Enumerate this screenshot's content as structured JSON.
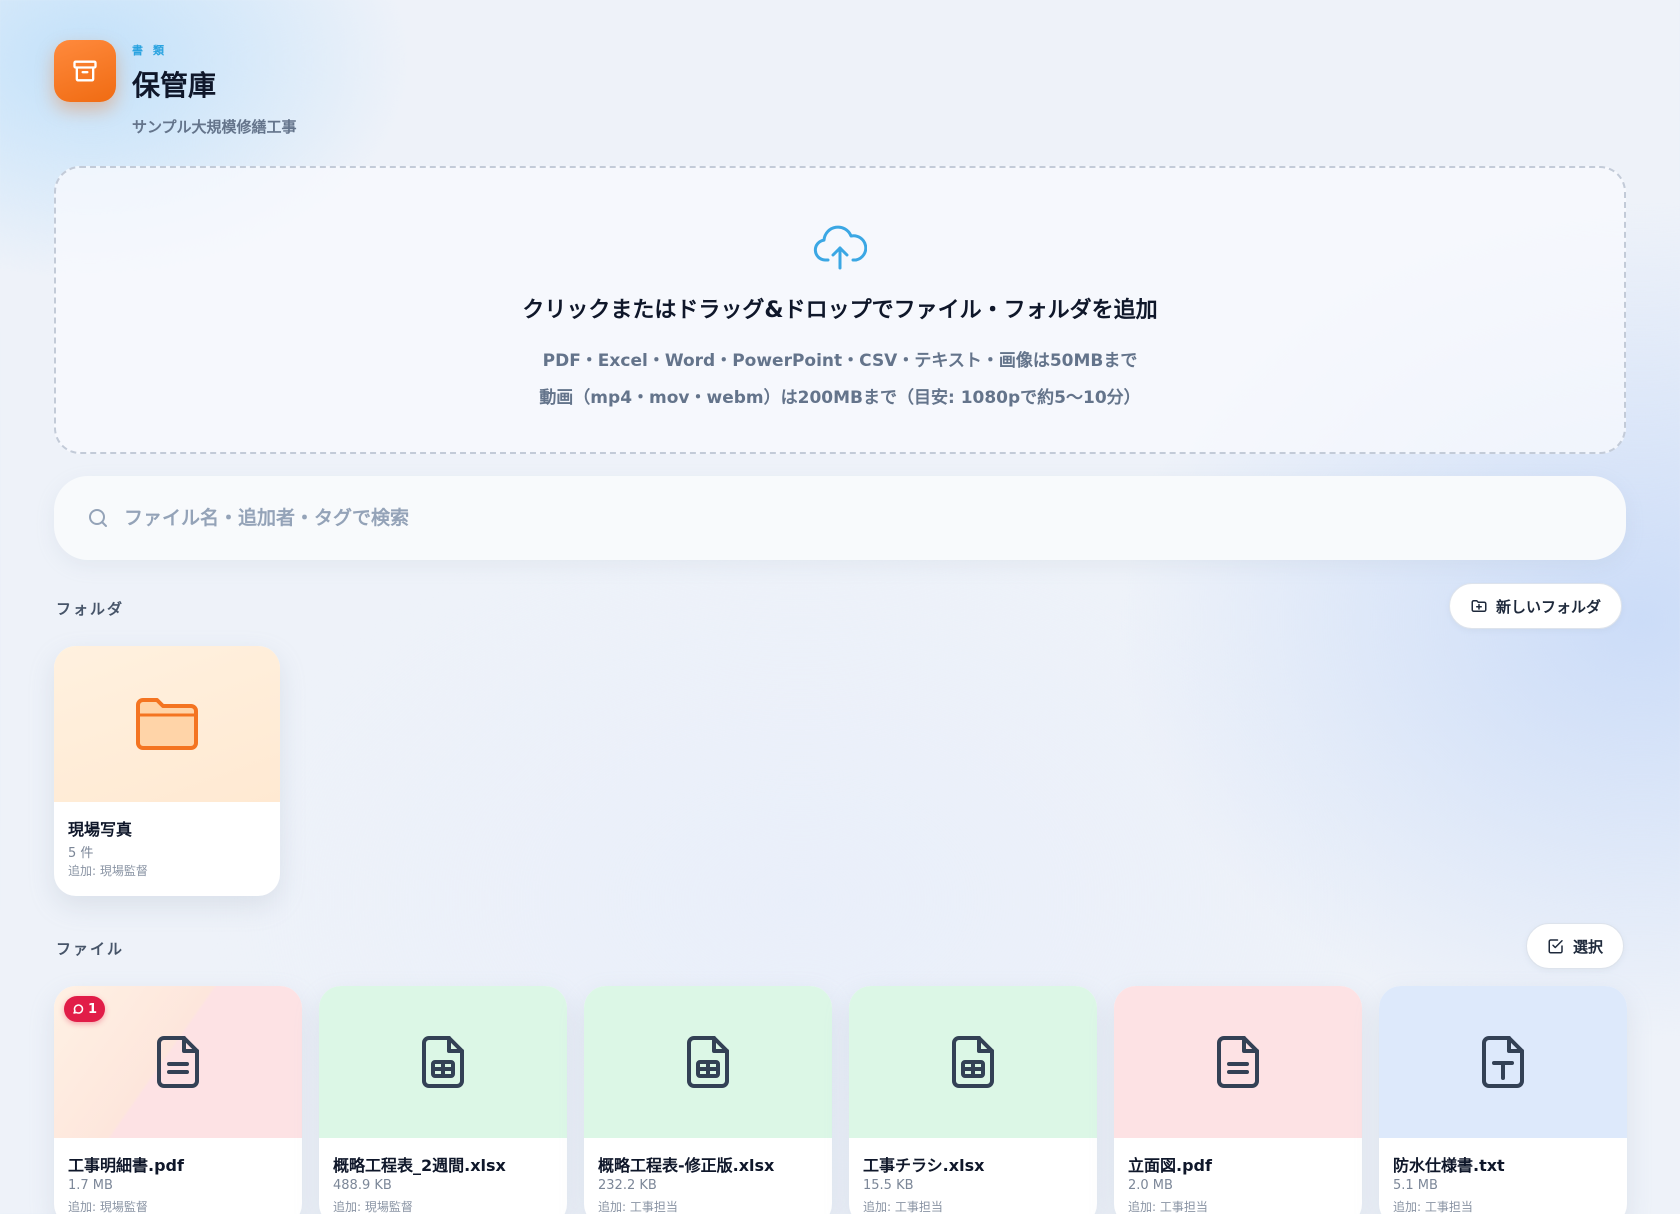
{
  "header": {
    "eyebrow": "書類",
    "title": "保管庫",
    "subtitle": "サンプル大規模修繕工事",
    "icon": "archive-box-icon",
    "accent": "#f47421"
  },
  "dropzone": {
    "icon": "cloud-upload-icon",
    "title": "クリックまたはドラッグ&ドロップでファイル・フォルダを追加",
    "line1": "PDF・Excel・Word・PowerPoint・CSV・テキスト・画像は50MBまで",
    "line2": "動画（mp4・mov・webm）は200MBまで（目安: 1080pで約5〜10分）"
  },
  "search": {
    "placeholder": "ファイル名・追加者・タグで検索",
    "value": "",
    "icon": "search-icon"
  },
  "folders_section": {
    "label": "フォルダ",
    "new_folder_label": "新しいフォルダ",
    "new_folder_icon": "folder-plus-icon",
    "items": [
      {
        "name": "現場写真",
        "count": "5 件",
        "added_by": "追加: 現場監督",
        "icon": "folder-icon"
      }
    ]
  },
  "files_section": {
    "label": "ファイル",
    "select_label": "選択",
    "select_icon": "checkbox-edit-icon",
    "items": [
      {
        "name": "工事明細書.pdf",
        "size": "1.7 MB",
        "added_by": "追加: 現場監督",
        "type": "pdf",
        "icon": "file-text-icon",
        "comments": "1"
      },
      {
        "name": "概略工程表_2週間.xlsx",
        "size": "488.9 KB",
        "added_by": "追加: 現場監督",
        "type": "xlsx",
        "icon": "file-spreadsheet-icon"
      },
      {
        "name": "概略工程表-修正版.xlsx",
        "size": "232.2 KB",
        "added_by": "追加: 工事担当",
        "type": "xlsx",
        "icon": "file-spreadsheet-icon"
      },
      {
        "name": "工事チラシ.xlsx",
        "size": "15.5 KB",
        "added_by": "追加: 工事担当",
        "type": "xlsx",
        "icon": "file-spreadsheet-icon"
      },
      {
        "name": "立面図.pdf",
        "size": "2.0 MB",
        "added_by": "追加: 工事担当",
        "type": "pdf",
        "icon": "file-text-icon"
      },
      {
        "name": "防水仕様書.txt",
        "size": "5.1 MB",
        "added_by": "追加: 工事担当",
        "type": "txt",
        "icon": "file-type-icon"
      }
    ]
  },
  "colors": {
    "pdf_thumb": "#fde2e4",
    "xlsx_thumb": "#dcf7e6",
    "txt_thumb": "#dde9fb",
    "folder_thumb": "#ffeedd",
    "folder_icon": "#f47421",
    "upload_icon": "#3ba7e4",
    "badge": "#e11d48"
  }
}
